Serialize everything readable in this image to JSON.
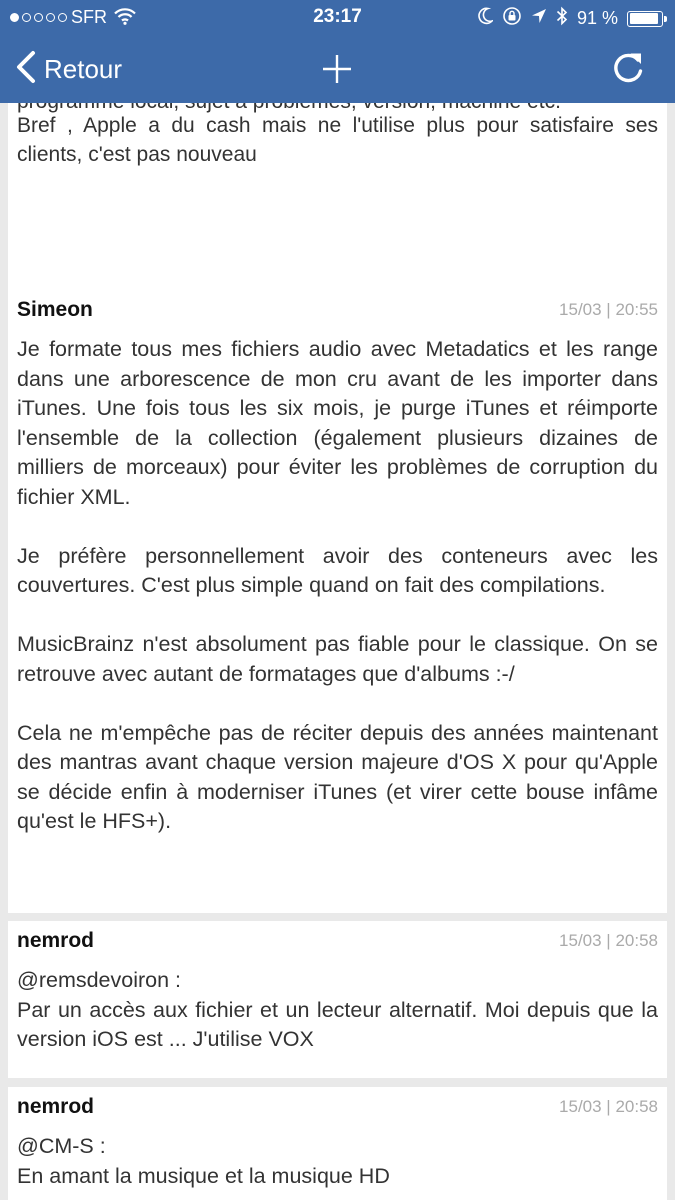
{
  "status_bar": {
    "carrier": "SFR",
    "time": "23:17",
    "battery": "91 %",
    "battery_level": 0.91
  },
  "nav": {
    "back_label": "Retour"
  },
  "posts": [
    {
      "cut_line": "programme local, sujet à problèmes, version, machine etc.",
      "text": "Bref , Apple a du cash mais ne l'utilise plus pour satisfaire ses clients, c'est pas nouveau"
    },
    {
      "author": "Simeon",
      "date": "15/03 | 20:55",
      "paragraphs": [
        "Je formate tous mes fichiers audio avec Metadatics et les range dans une arborescence de mon cru avant de les importer dans iTunes. Une fois tous les six mois, je purge iTunes et réimporte l'ensemble de la collection (également plusieurs dizaines de milliers de morceaux) pour éviter les problèmes de corruption du fichier XML.",
        "Je préfère personnellement avoir des conteneurs avec les couvertures. C'est plus simple quand on fait des compilations.",
        "MusicBrainz n'est absolument pas fiable pour le classique. On se retrouve avec autant de formatages que d'albums :-/",
        "Cela ne m'empêche pas de réciter depuis des années maintenant des mantras avant chaque version majeure d'OS X pour qu'Apple se décide enfin à moderniser iTunes (et virer cette bouse infâme qu'est le HFS+)."
      ]
    },
    {
      "author": "nemrod",
      "date": "15/03 | 20:58",
      "paragraphs": [
        "@remsdevoiron :",
        "Par un accès aux fichier et un lecteur alternatif. Moi depuis que la version iOS est ... J'utilise VOX"
      ]
    },
    {
      "author": "nemrod",
      "date": "15/03 | 20:58",
      "paragraphs": [
        "@CM-S :",
        "En amant la musique et la musique HD"
      ]
    }
  ],
  "colors": {
    "nav_background": "#3d6aa9",
    "page_background": "#e9e9e9",
    "card_background": "#ffffff",
    "text": "#333333",
    "date": "#aaaaaa"
  },
  "icons": {
    "back": "chevron-left-icon",
    "add": "plus-icon",
    "refresh": "refresh-icon",
    "wifi": "wifi-icon",
    "moon": "moon-icon",
    "lock_rotation": "rotation-lock-icon",
    "location": "location-arrow-icon",
    "bluetooth": "bluetooth-icon",
    "battery": "battery-icon"
  }
}
